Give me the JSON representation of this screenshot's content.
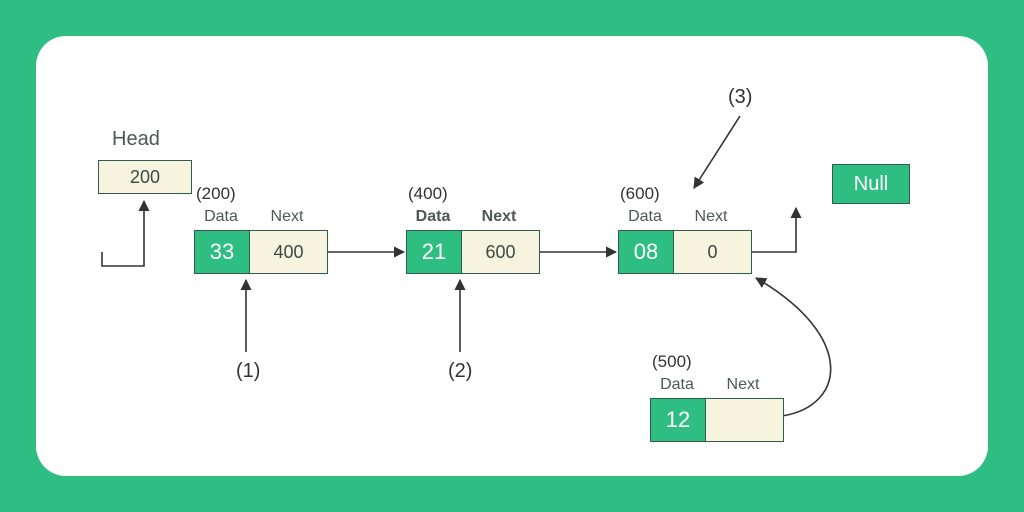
{
  "head": {
    "label": "Head",
    "value": "200"
  },
  "null_label": "Null",
  "field_labels": {
    "data": "Data",
    "next": "Next"
  },
  "nodes": [
    {
      "address": "(200)",
      "data": "33",
      "next": "400",
      "bold_labels": false
    },
    {
      "address": "(400)",
      "data": "21",
      "next": "600",
      "bold_labels": true
    },
    {
      "address": "(600)",
      "data": "08",
      "next": "0",
      "bold_labels": false
    }
  ],
  "new_node": {
    "address": "(500)",
    "data": "12",
    "next": ""
  },
  "pointers": {
    "p1": "(1)",
    "p2": "(2)",
    "p3": "(3)"
  }
}
